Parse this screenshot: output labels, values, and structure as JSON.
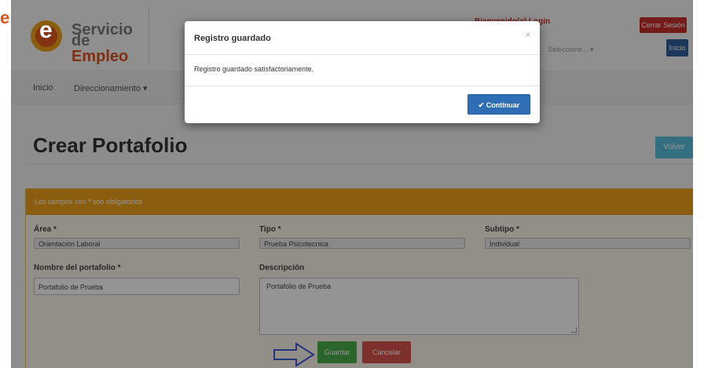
{
  "header": {
    "logo_line1": "Servicio",
    "logo_line2_a": "de ",
    "logo_line2_b": "Empleo",
    "logo_letter": "e",
    "top_red_text": "Bienvenido(a) Login",
    "select_hint": "Seleccione... ▾",
    "logout_label": "Cerrar Sesión",
    "home_label": "Inicio"
  },
  "edge_letter": "e",
  "nav": {
    "items": [
      {
        "label": "Inicio"
      },
      {
        "label": "Direccionamiento ▾"
      }
    ]
  },
  "page": {
    "title": "Crear Portafolio",
    "back_label": "Volver"
  },
  "form": {
    "notice": "Los campos con * son obligatorios",
    "area": {
      "label": "Área *",
      "value": "Orientación Laboral"
    },
    "tipo": {
      "label": "Tipo *",
      "value": "Prueba Psicotecnica"
    },
    "subtipo": {
      "label": "Subtipo *",
      "value": "Individual"
    },
    "nombre": {
      "label": "Nombre del portafolio *",
      "value": "Portafolio de Prueba"
    },
    "descripcion": {
      "label": "Descripción",
      "value": "Portafolio de Prueba"
    },
    "save_label": "Guardar",
    "cancel_label": "Cancelar"
  },
  "modal": {
    "title": "Registro guardado",
    "close": "×",
    "message": "Registro guardado satisfactoriamente.",
    "continue_label": "✔ Continuar"
  },
  "colors": {
    "brand_orange": "#f0a21b",
    "danger": "#d9534f",
    "success": "#4cae4c",
    "primary": "#2f6db5",
    "info": "#5bc0de"
  }
}
